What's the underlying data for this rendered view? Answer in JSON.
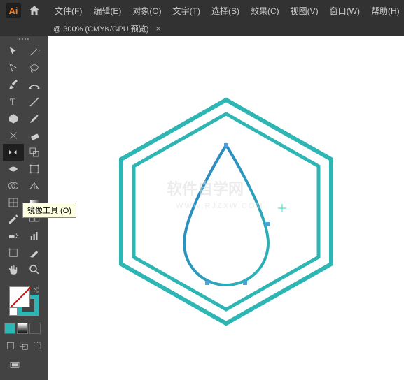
{
  "app": {
    "logo_text": "Ai"
  },
  "menu": {
    "file": "文件(F)",
    "edit": "编辑(E)",
    "object": "对象(O)",
    "type": "文字(T)",
    "select": "选择(S)",
    "effect": "效果(C)",
    "view": "视图(V)",
    "window": "窗口(W)",
    "help": "帮助(H)"
  },
  "tab": {
    "title": "@ 300% (CMYK/GPU 预览)",
    "close": "×"
  },
  "tooltip": {
    "reflect_tool": "镜像工具 (O)"
  },
  "colors": {
    "stroke": "#2db6b3",
    "accent": "#2db6b3",
    "drop_gradient_start": "#2a7fc4",
    "drop_gradient_end": "#2db6b3"
  },
  "canvas": {
    "shape": "hexagon-double-stroke",
    "inner_shape": "water-drop"
  }
}
